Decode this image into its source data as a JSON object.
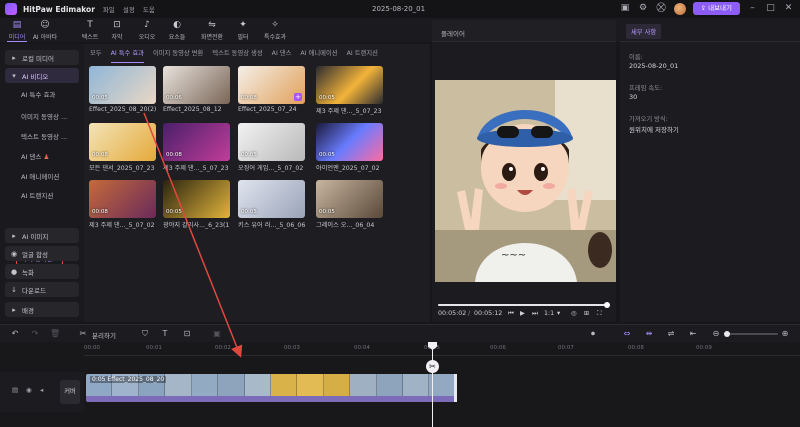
{
  "app": {
    "name": "HitPaw Edimakor",
    "menu": [
      "파일",
      "설정",
      "도움"
    ],
    "doc_title": "2025-08-20_01",
    "export_label": "내보내기"
  },
  "toolbar": [
    {
      "label": "미디어",
      "icon": "media-icon",
      "active": true
    },
    {
      "label": "AI 아바타",
      "icon": "avatar-icon",
      "active": false
    },
    {
      "label": "텍스트",
      "icon": "text-icon",
      "active": false
    },
    {
      "label": "자막",
      "icon": "subtitle-icon",
      "active": false
    },
    {
      "label": "오디오",
      "icon": "music-icon",
      "active": false
    },
    {
      "label": "요소들",
      "icon": "elements-icon",
      "active": false
    },
    {
      "label": "화면전환",
      "icon": "transition-icon",
      "active": false
    },
    {
      "label": "필터",
      "icon": "filter-icon",
      "active": false
    },
    {
      "label": "특수효과",
      "icon": "effects-icon",
      "active": false
    }
  ],
  "sidebar": {
    "local_media": "로컬 미디어",
    "ai_video": "AI 비디오",
    "sub_items": [
      "AI 특수 효과",
      "이미지 동영상 ...",
      "텍스트 동영상 ...",
      "AI 댄스",
      "AI 애니메이션",
      "AI 트랜지션",
      "나의 창작물"
    ],
    "groups": [
      "AI 이미지",
      "얼굴 합성",
      "녹화",
      "다운로드",
      "배경"
    ]
  },
  "media": {
    "tabs": [
      "모두",
      "AI 특수 효과",
      "이미지 동영상 변환",
      "텍스트 동영상 생성",
      "AI 댄스",
      "AI 애니메이션",
      "AI 트랜지션"
    ],
    "cards": [
      {
        "dur": "00:05",
        "name": "Effect_2025_08_20(2)"
      },
      {
        "dur": "00:06",
        "name": "Effect_2025_08_12"
      },
      {
        "dur": "00:08",
        "name": "Effect_2025_07_24"
      },
      {
        "dur": "00:05",
        "name": "제3 주제 댄..._5_07_23"
      },
      {
        "dur": "00:08",
        "name": "모든 댄서_2025_07_23"
      },
      {
        "dur": "00:08",
        "name": "제3 주제 댄..._5_07_23"
      },
      {
        "dur": "00:05",
        "name": "오징어 게임..._5_07_02"
      },
      {
        "dur": "00:05",
        "name": "아이언맨_2025_07_02"
      },
      {
        "dur": "00:08",
        "name": "제3 주제 댄..._5_07_02"
      },
      {
        "dur": "00:05",
        "name": "광야지 갈리사..._6_23(1)"
      },
      {
        "dur": "00:05",
        "name": "키스 유어 러..._5_06_06"
      },
      {
        "dur": "00:05",
        "name": "그레이스 오..._06_04"
      }
    ]
  },
  "player": {
    "label": "플레이어",
    "time_current": "00:05:02",
    "time_total": "00:05:12",
    "speed": "1:1",
    "progress": 0.98
  },
  "details": {
    "tab": "세부 사항",
    "name_label": "이름:",
    "name_value": "2025-08-20_01",
    "fps_label": "프레임 속도:",
    "fps_value": "30",
    "import_label": "가져오기 방식:",
    "import_value": "원위치에 저장하기"
  },
  "timeline": {
    "split_label": "분리하기",
    "ruler": [
      "00:00",
      "00:01",
      "00:02",
      "00:03",
      "00:04",
      "00:05",
      "00:06",
      "00:07",
      "00:08",
      "00:09"
    ],
    "cover_label": "커버",
    "clip_label": "0:05  Effect_2025_08_20"
  },
  "colors": {
    "accent": "#a78bfa",
    "export": "#8b5cf6",
    "highlight": "#e0473f"
  }
}
